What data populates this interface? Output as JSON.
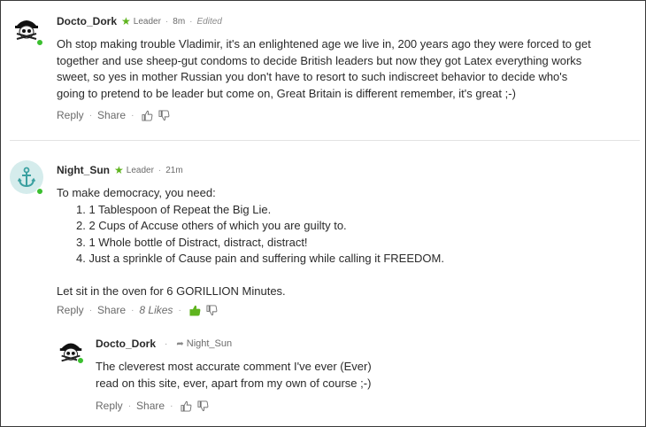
{
  "comments": [
    {
      "author": "Docto_Dork",
      "badge": "Leader",
      "time": "8m",
      "edited": "Edited",
      "text_lines": [
        "Oh stop making trouble Vladimir, it's an enlightened age we live in, 200 years ago they were forced to get",
        "together and use sheep-gut condoms to decide British leaders but now they got Latex everything works",
        "sweet, so yes in mother Russian you don't have to resort to such indiscreet behavior to decide who's",
        "going to pretend to be leader but come on, Great Britain is different remember, it's great ;-)"
      ],
      "reply_label": "Reply",
      "share_label": "Share"
    },
    {
      "author": "Night_Sun",
      "badge": "Leader",
      "time": "21m",
      "intro": "To make democracy, you need:",
      "list": [
        "1. 1 Tablespoon of Repeat the Big Lie.",
        "2. 2 Cups of Accuse others of which you are guilty to.",
        "3. 1 Whole bottle of Distract, distract, distract!",
        "4. Just a sprinkle of Cause pain and suffering while calling it FREEDOM."
      ],
      "outro": "Let sit in the oven for 6 GORILLION Minutes.",
      "reply_label": "Reply",
      "share_label": "Share",
      "likes": "8 Likes"
    },
    {
      "author": "Docto_Dork",
      "reply_to": "Night_Sun",
      "text_lines": [
        "The cleverest most accurate comment I've ever (Ever)",
        "read on this site, ever, apart from my own of course ;-)"
      ],
      "reply_label": "Reply",
      "share_label": "Share"
    }
  ],
  "colors": {
    "online": "#3bbf2f",
    "leader_star": "#5fb41f",
    "liked_thumb": "#5fb41f",
    "anchor_avatar_bg": "#d5ecec",
    "anchor_icon": "#3aa0a0"
  }
}
